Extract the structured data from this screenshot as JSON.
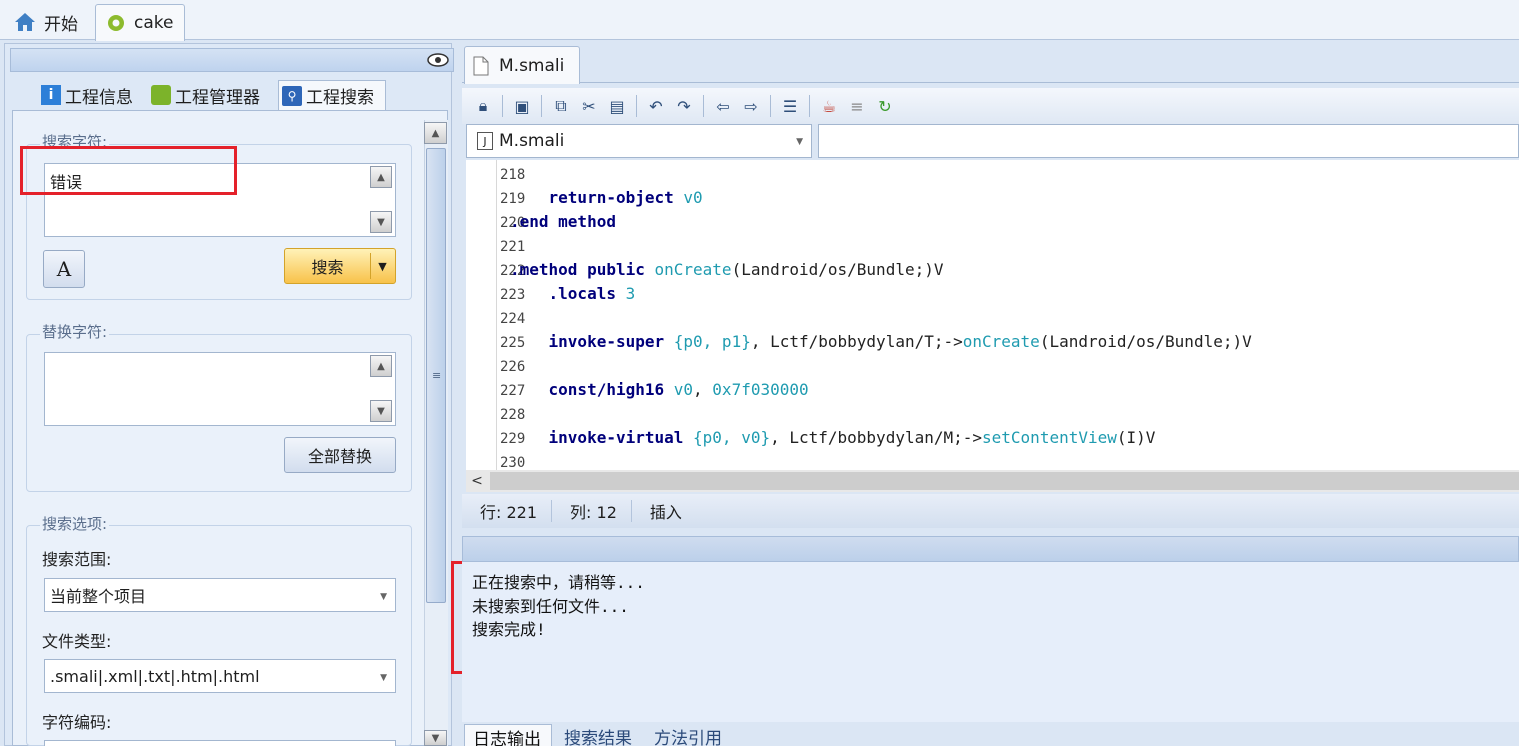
{
  "tabs": {
    "start_label": "开始",
    "project_label": "cake"
  },
  "left": {
    "tabs": {
      "info": "工程信息",
      "manager": "工程管理器",
      "search": "工程搜索"
    },
    "search_group_title": "搜索字符:",
    "search_value": "错误",
    "search_button": "搜索",
    "replace_group_title": "替换字符:",
    "replace_value": "",
    "replace_all_button": "全部替换",
    "options_title": "搜索选项:",
    "scope_label": "搜索范围:",
    "scope_value": "当前整个项目",
    "filetype_label": "文件类型:",
    "filetype_value": ".smali|.xml|.txt|.htm|.html",
    "encoding_label": "字符编码:"
  },
  "editor": {
    "tab_label": "M.smali",
    "file_combo_value": "M.smali",
    "status": {
      "row": "行: 221",
      "col": "列: 12",
      "mode": "插入"
    }
  },
  "code_lines": [
    {
      "n": "218",
      "text": ""
    },
    {
      "n": "219",
      "text": "    return-object v0"
    },
    {
      "n": "220",
      "text": ".end method"
    },
    {
      "n": "221",
      "text": ""
    },
    {
      "n": "222",
      "text": ".method public onCreate(Landroid/os/Bundle;)V"
    },
    {
      "n": "223",
      "text": "    .locals 3"
    },
    {
      "n": "224",
      "text": ""
    },
    {
      "n": "225",
      "text": "    invoke-super {p0, p1}, Lctf/bobbydylan/T;->onCreate(Landroid/os/Bundle;)V"
    },
    {
      "n": "226",
      "text": ""
    },
    {
      "n": "227",
      "text": "    const/high16 v0, 0x7f030000"
    },
    {
      "n": "228",
      "text": ""
    },
    {
      "n": "229",
      "text": "    invoke-virtual {p0, v0}, Lctf/bobbydylan/M;->setContentView(I)V"
    },
    {
      "n": "230",
      "text": ""
    }
  ],
  "log": {
    "lines": [
      "正在搜索中，请稍等...",
      "未搜索到任何文件...",
      "搜索完成!"
    ]
  },
  "bottom_tabs": [
    "日志输出",
    "搜索结果",
    "方法引用"
  ]
}
